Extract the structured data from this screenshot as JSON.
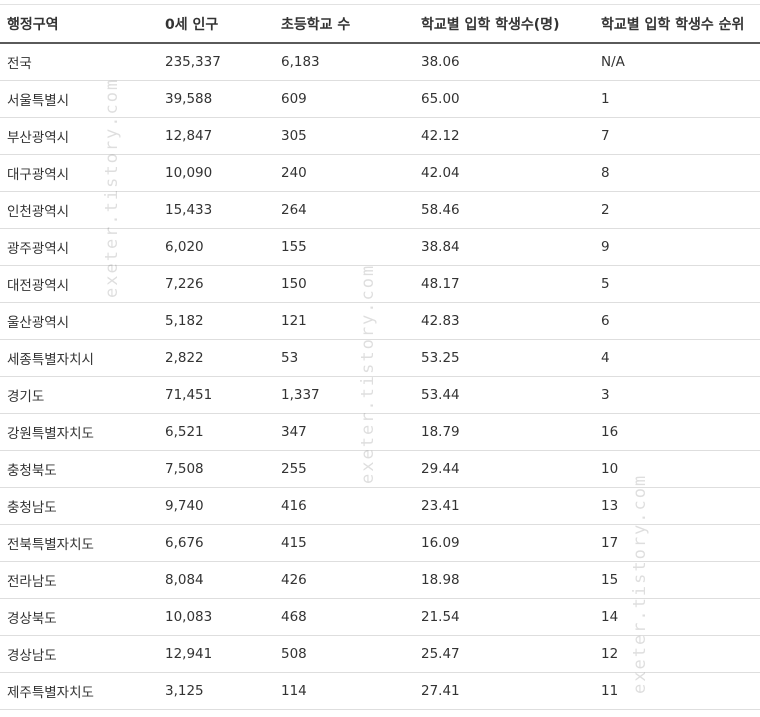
{
  "table": {
    "headers": [
      "행정구역",
      "0세 인구",
      "초등학교 수",
      "학교별 입학 학생수(명)",
      "학교별 입학 학생수 순위"
    ],
    "rows": [
      [
        "전국",
        "235,337",
        "6,183",
        "38.06",
        "N/A"
      ],
      [
        "서울특별시",
        "39,588",
        "609",
        "65.00",
        "1"
      ],
      [
        "부산광역시",
        "12,847",
        "305",
        "42.12",
        "7"
      ],
      [
        "대구광역시",
        "10,090",
        "240",
        "42.04",
        "8"
      ],
      [
        "인천광역시",
        "15,433",
        "264",
        "58.46",
        "2"
      ],
      [
        "광주광역시",
        "6,020",
        "155",
        "38.84",
        "9"
      ],
      [
        "대전광역시",
        "7,226",
        "150",
        "48.17",
        "5"
      ],
      [
        "울산광역시",
        "5,182",
        "121",
        "42.83",
        "6"
      ],
      [
        "세종특별자치시",
        "2,822",
        "53",
        "53.25",
        "4"
      ],
      [
        "경기도",
        "71,451",
        "1,337",
        "53.44",
        "3"
      ],
      [
        "강원특별자치도",
        "6,521",
        "347",
        "18.79",
        "16"
      ],
      [
        "충청북도",
        "7,508",
        "255",
        "29.44",
        "10"
      ],
      [
        "충청남도",
        "9,740",
        "416",
        "23.41",
        "13"
      ],
      [
        "전북특별자치도",
        "6,676",
        "415",
        "16.09",
        "17"
      ],
      [
        "전라남도",
        "8,084",
        "426",
        "18.98",
        "15"
      ],
      [
        "경상북도",
        "10,083",
        "468",
        "21.54",
        "14"
      ],
      [
        "경상남도",
        "12,941",
        "508",
        "25.47",
        "12"
      ],
      [
        "제주특별자치도",
        "3,125",
        "114",
        "27.41",
        "11"
      ]
    ]
  },
  "watermark": {
    "text": "exeter.tistory.com"
  }
}
